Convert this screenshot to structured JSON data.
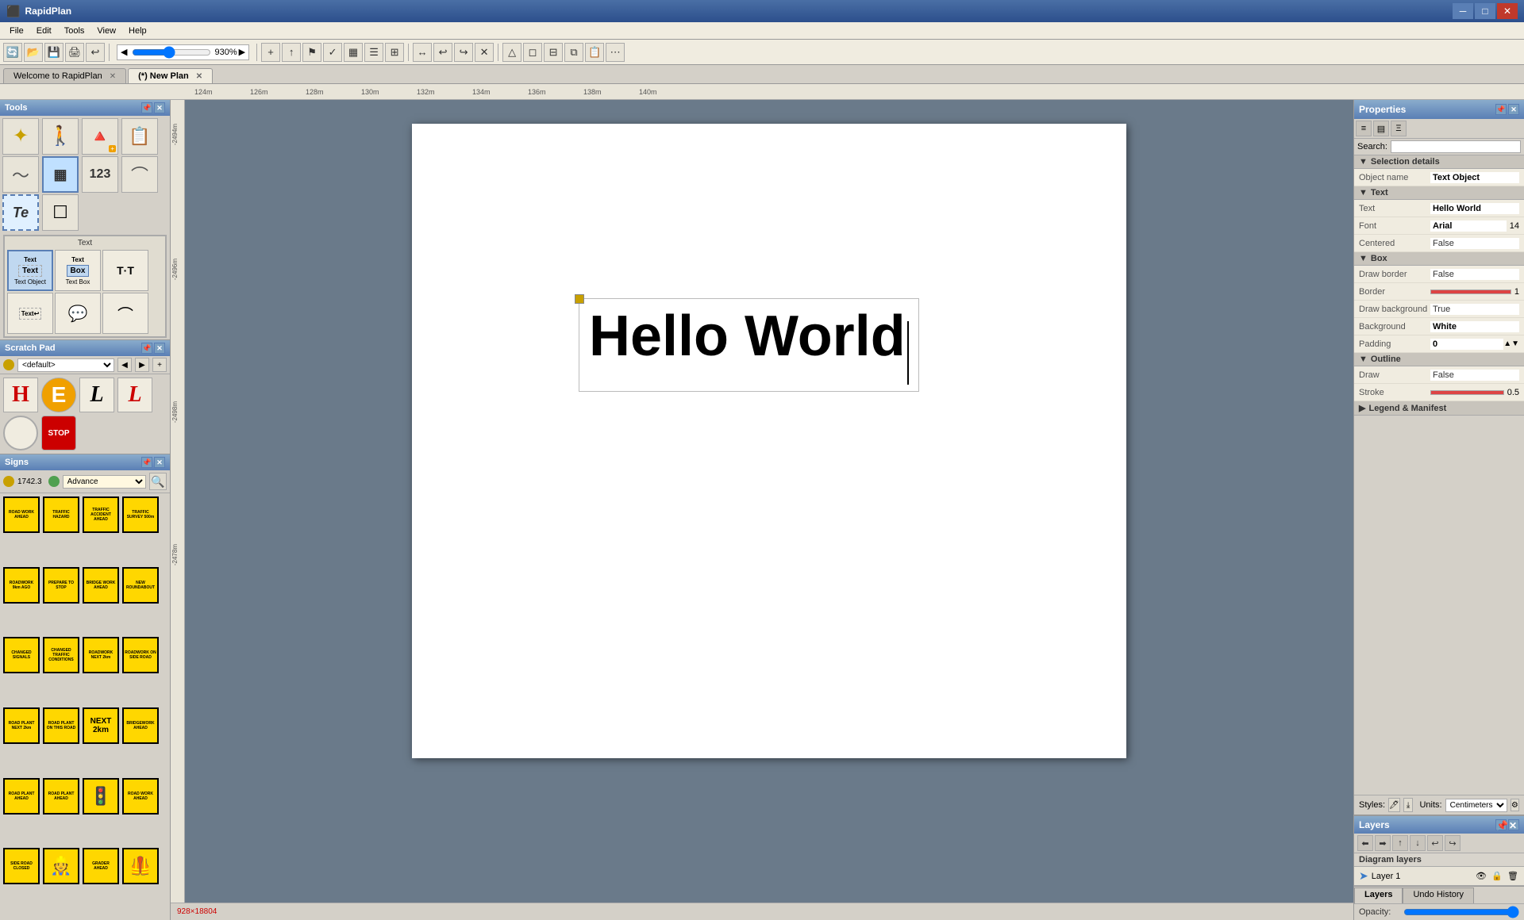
{
  "app": {
    "title": "RapidPlan",
    "window_controls": [
      "─",
      "□",
      "✕"
    ]
  },
  "menu": {
    "items": [
      "File",
      "Edit",
      "Tools",
      "View",
      "Help"
    ]
  },
  "toolbar": {
    "zoom_value": "930%",
    "zoom_placeholder": "930%"
  },
  "tabs": [
    {
      "label": "Welcome to RapidPlan",
      "active": false
    },
    {
      "label": "(*) New Plan",
      "active": true
    }
  ],
  "ruler": {
    "marks": [
      "124m",
      "126m",
      "128m",
      "130m",
      "132m",
      "134m",
      "136m",
      "138m",
      "140m"
    ]
  },
  "tools_panel": {
    "title": "Tools",
    "tools": [
      {
        "name": "select-tool",
        "icon": "↗",
        "label": ""
      },
      {
        "name": "pedestrian-tool",
        "icon": "🚶",
        "label": ""
      },
      {
        "name": "cone-tool",
        "icon": "🔺",
        "label": ""
      },
      {
        "name": "sign-board-tool",
        "icon": "📋",
        "label": ""
      },
      {
        "name": "curve-tool",
        "icon": "〜",
        "label": ""
      },
      {
        "name": "table-tool",
        "icon": "▦",
        "label": ""
      },
      {
        "name": "number-tool",
        "icon": "123",
        "label": ""
      },
      {
        "name": "arch-tool",
        "icon": "⌒",
        "label": ""
      },
      {
        "name": "text-tool",
        "icon": "Te",
        "label": ""
      },
      {
        "name": "textbox-tool",
        "icon": "☐",
        "label": "Text Box",
        "active": true
      }
    ],
    "text_label": "Text",
    "text_subtool_label": "Text Object",
    "text_subtools": [
      {
        "name": "text-obj-1",
        "icon": "Text",
        "label": "Text Object"
      },
      {
        "name": "text-obj-2",
        "icon": "Text Box",
        "label": "Text Box"
      },
      {
        "name": "text-obj-3",
        "icon": "T·T",
        "label": ""
      }
    ],
    "text_subtools2": [
      {
        "name": "text-obj-4",
        "icon": "↩",
        "label": ""
      },
      {
        "name": "text-obj-5",
        "icon": "💬",
        "label": ""
      },
      {
        "name": "text-obj-6",
        "icon": "⌒",
        "label": ""
      }
    ]
  },
  "scratch_pad": {
    "title": "Scratch Pad",
    "default_label": "<default>",
    "items": [
      {
        "name": "red-h",
        "display": "H",
        "color": "red"
      },
      {
        "name": "orange-e",
        "display": "E",
        "color": "orange"
      },
      {
        "name": "black-l",
        "display": "L",
        "color": "black"
      },
      {
        "name": "red-l",
        "display": "L",
        "color": "#cc0000"
      },
      {
        "name": "circle",
        "display": "○",
        "color": "black"
      },
      {
        "name": "stop-sign",
        "display": "STOP",
        "color": "red"
      }
    ]
  },
  "signs_panel": {
    "title": "Signs",
    "id_label": "1742.3",
    "category_label": "Advance",
    "signs": [
      {
        "name": "roadwork-ahead",
        "text": "ROAD WORK AHEAD",
        "style": "yellow"
      },
      {
        "name": "traffic-hazard",
        "text": "TRAFFIC HAZARD",
        "style": "yellow"
      },
      {
        "name": "traffic-accident-ahead",
        "text": "TRAFFIC ACCIDENT AHEAD",
        "style": "yellow"
      },
      {
        "name": "traffic-survey",
        "text": "TRAFFIC SURVEY 500m",
        "style": "yellow"
      },
      {
        "name": "roadwork-min-ago",
        "text": "ROADWORK 9km AGO",
        "style": "yellow"
      },
      {
        "name": "prepare-to-stop",
        "text": "PREPARE TO STOP",
        "style": "yellow"
      },
      {
        "name": "bridgework",
        "text": "BRIDGEWORK AHEAD",
        "style": "yellow"
      },
      {
        "name": "new-roundabout",
        "text": "NEW ROUNDABOUT",
        "style": "yellow"
      },
      {
        "name": "changed-signals",
        "text": "CHANGED SIGNALS",
        "style": "yellow"
      },
      {
        "name": "changed-traffic-cond",
        "text": "CHANGED TRAFFIC CONDITIONS",
        "style": "yellow"
      },
      {
        "name": "roadwork-next2km",
        "text": "ROADWORK NEXT 2km",
        "style": "yellow"
      },
      {
        "name": "roadwork-on-side",
        "text": "ROADWORK ON SIDE ROAD",
        "style": "yellow"
      },
      {
        "name": "road-plant-next",
        "text": "ROAD PLANT NEXT 2km",
        "style": "yellow"
      },
      {
        "name": "road-plant-on-this-road",
        "text": "ROAD PLANT ON THIS ROAD",
        "style": "yellow"
      },
      {
        "name": "next-2km",
        "text": "NEXT 2km",
        "style": "yellow"
      },
      {
        "name": "bridgework-ahead2",
        "text": "BRIDGEWORK AHEAD",
        "style": "yellow"
      },
      {
        "name": "road-plant-ahead",
        "text": "ROAD PLANT AHEAD",
        "style": "yellow"
      },
      {
        "name": "road-plant-ahead2",
        "text": "ROAD PLANT AHEAD",
        "style": "yellow"
      },
      {
        "name": "traffic-light",
        "text": "🚦",
        "style": "yellow"
      },
      {
        "name": "road-work-ahead-2",
        "text": "ROAD WORK AHEAD",
        "style": "yellow"
      },
      {
        "name": "side-road-closed",
        "text": "SIDE ROAD CLOSED",
        "style": "yellow"
      },
      {
        "name": "pedestrian",
        "text": "👷",
        "style": "yellow"
      },
      {
        "name": "grader-ahead",
        "text": "GRADER AHEAD",
        "style": "yellow"
      },
      {
        "name": "worker-sign",
        "text": "🦺",
        "style": "yellow"
      }
    ]
  },
  "canvas": {
    "text": "Hello World",
    "font": "Arial",
    "font_size": "72"
  },
  "status_bar": {
    "coordinates": "928×18804"
  },
  "properties": {
    "title": "Properties",
    "search_placeholder": "Search:",
    "sections": {
      "selection_details": {
        "label": "Selection details",
        "object_name_label": "Object name",
        "object_name_value": "Text Object"
      },
      "text": {
        "label": "Text",
        "text_label": "Text",
        "text_value": "Hello World",
        "font_label": "Font",
        "font_value": "Arial",
        "font_size": "14",
        "centered_label": "Centered",
        "centered_value": "False"
      },
      "box": {
        "label": "Box",
        "draw_border_label": "Draw border",
        "draw_border_value": "False",
        "border_label": "Border",
        "border_value": "1",
        "draw_bg_label": "Draw background",
        "draw_bg_value": "True",
        "background_label": "Background",
        "background_value": "White",
        "padding_label": "Padding",
        "padding_value": "0"
      },
      "outline": {
        "label": "Outline",
        "draw_label": "Draw",
        "draw_value": "False",
        "stroke_label": "Stroke",
        "stroke_value": "0.5"
      },
      "legend": {
        "label": "Legend & Manifest"
      }
    },
    "styles_label": "Styles:",
    "units_label": "Units:",
    "units_value": "Centimeters"
  },
  "layers": {
    "title": "Layers",
    "diagram_layers_label": "Diagram layers",
    "layers": [
      {
        "name": "Layer 1",
        "visible": true
      }
    ]
  },
  "bottom_tabs": [
    {
      "label": "Layers",
      "active": true
    },
    {
      "label": "Undo History",
      "active": false
    }
  ],
  "opacity": {
    "label": "Opacity:"
  }
}
